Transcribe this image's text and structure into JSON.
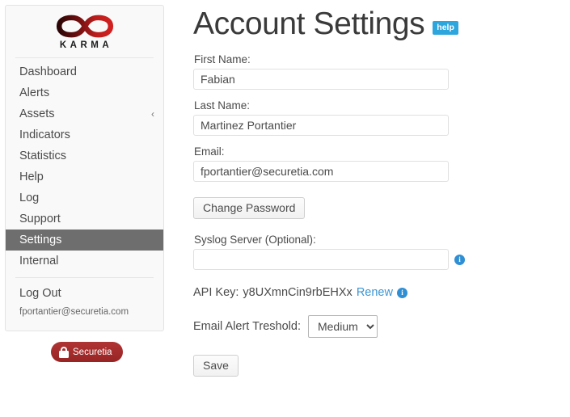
{
  "sidebar": {
    "brand": {
      "logo_icon": "infinity-icon",
      "wordmark": "KARMA",
      "logo_color_dark": "#3a0a0a",
      "logo_color_bright": "#c81a1a"
    },
    "items": [
      {
        "label": "Dashboard",
        "active": false,
        "chevron": ""
      },
      {
        "label": "Alerts",
        "active": false,
        "chevron": ""
      },
      {
        "label": "Assets",
        "active": false,
        "chevron": "‹"
      },
      {
        "label": "Indicators",
        "active": false,
        "chevron": ""
      },
      {
        "label": "Statistics",
        "active": false,
        "chevron": ""
      },
      {
        "label": "Help",
        "active": false,
        "chevron": ""
      },
      {
        "label": "Log",
        "active": false,
        "chevron": ""
      },
      {
        "label": "Support",
        "active": false,
        "chevron": ""
      },
      {
        "label": "Settings",
        "active": true,
        "chevron": ""
      },
      {
        "label": "Internal",
        "active": false,
        "chevron": ""
      }
    ],
    "logout_label": "Log Out",
    "user_email": "fportantier@securetia.com",
    "badge": {
      "label": "Securetia",
      "icon": "lock-icon",
      "color": "#a52a2a"
    }
  },
  "main": {
    "title": "Account Settings",
    "help_badge": "help",
    "help_badge_color": "#2da5dd",
    "fields": {
      "first_name": {
        "label": "First Name:",
        "value": "Fabian",
        "placeholder": ""
      },
      "last_name": {
        "label": "Last Name:",
        "value": "Martinez Portantier",
        "placeholder": ""
      },
      "email": {
        "label": "Email:",
        "value": "fportantier@securetia.com",
        "placeholder": ""
      },
      "syslog": {
        "label": "Syslog Server (Optional):",
        "value": "",
        "placeholder": ""
      }
    },
    "change_password_label": "Change Password",
    "api_key": {
      "label": "API Key:",
      "value": "y8UXmnCin9rbEHXx",
      "renew_label": "Renew",
      "link_color": "#3b95d4"
    },
    "threshold": {
      "label": "Email Alert Treshold:",
      "selected": "Medium",
      "options": [
        "Medium"
      ]
    },
    "save_label": "Save",
    "info_icon": "info-icon"
  }
}
